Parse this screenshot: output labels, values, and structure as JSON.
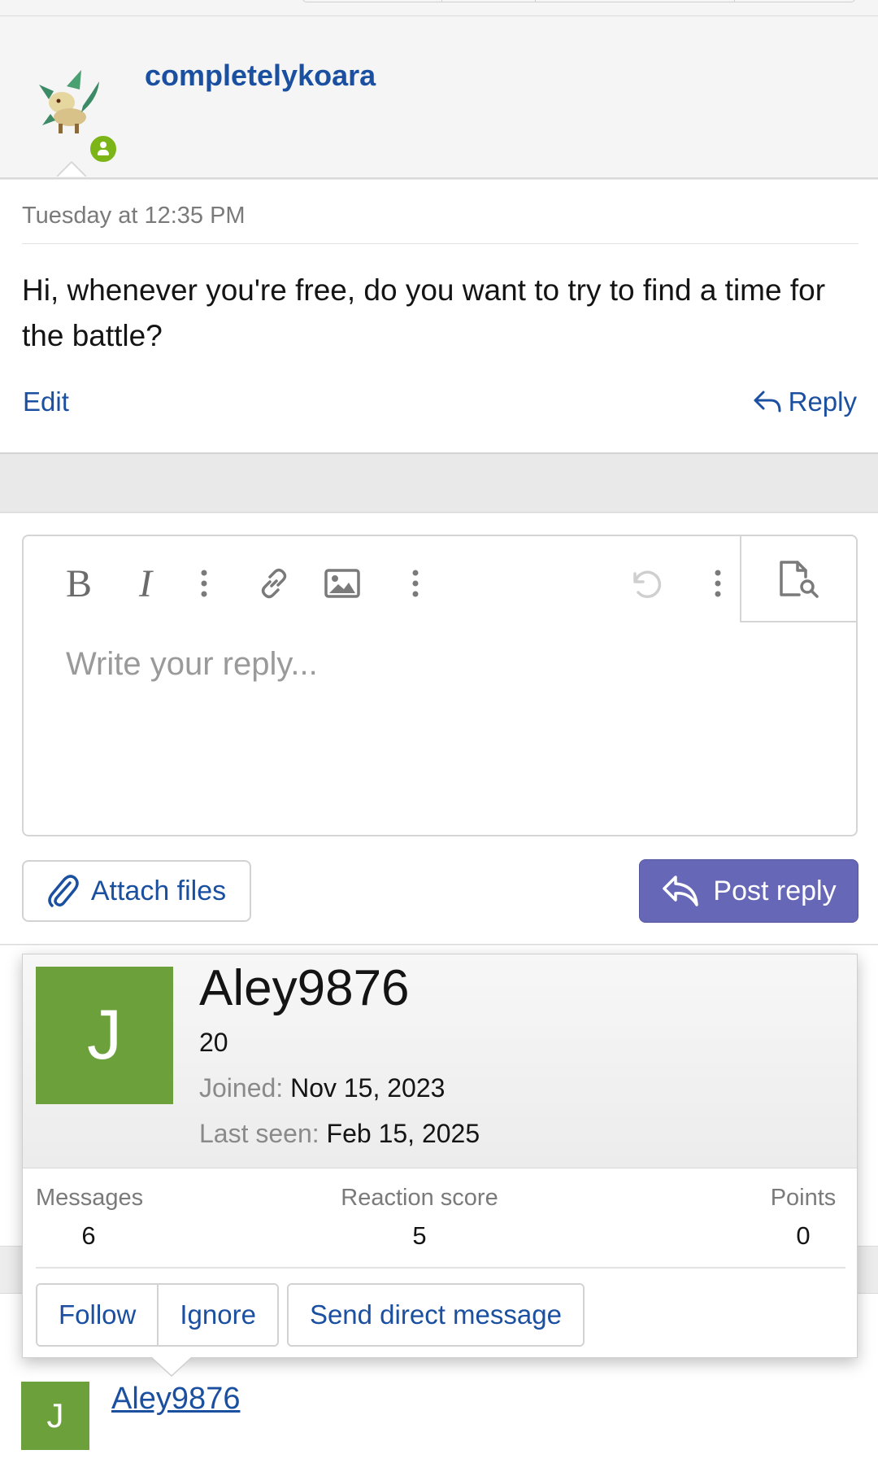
{
  "post": {
    "username": "completelykoara",
    "date": "Tuesday at 12:35 PM",
    "body": "Hi, whenever you're free, do you want to try to find a time for the battle?",
    "actions": {
      "edit": "Edit",
      "reply": "Reply"
    },
    "online_icon": "user-online-icon"
  },
  "composer": {
    "toolbar": {
      "bold": "B",
      "italic": "I",
      "icons": [
        "more-options-icon",
        "link-icon",
        "image-icon",
        "more-options-icon",
        "undo-icon",
        "more-options-icon",
        "preview-icon"
      ]
    },
    "placeholder": "Write your reply...",
    "attach_label": "Attach files",
    "post_label": "Post reply",
    "post_color": "#6767b8"
  },
  "member_card": {
    "avatar_letter": "J",
    "avatar_color": "#6ba03a",
    "name": "Aley9876",
    "title": "20",
    "joined_label": "Joined:",
    "joined_value": "Nov 15, 2023",
    "last_seen_label": "Last seen:",
    "last_seen_value": "Feb 15, 2025",
    "stats": {
      "messages_label": "Messages",
      "messages_value": "6",
      "reaction_label": "Reaction score",
      "reaction_value": "5",
      "points_label": "Points",
      "points_value": "0"
    },
    "buttons": {
      "follow": "Follow",
      "ignore": "Ignore",
      "message": "Send direct message"
    }
  },
  "footer_user": {
    "avatar_letter": "J",
    "name": "Aley9876"
  }
}
